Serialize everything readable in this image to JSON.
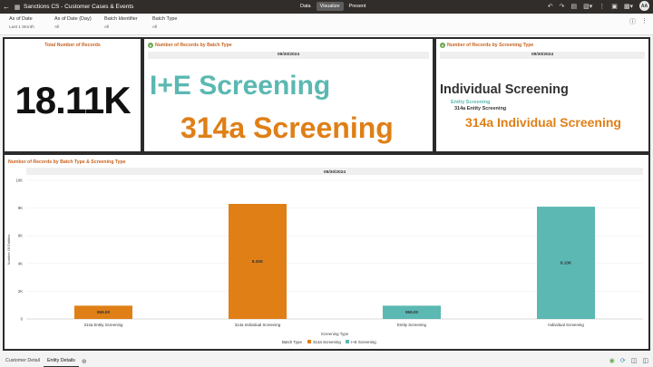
{
  "app": {
    "title": "Sanctions CS - Customer Cases & Events",
    "modes": [
      "Data",
      "Visualize",
      "Present"
    ],
    "active_mode": "Visualize",
    "avatar_initials": "AA"
  },
  "filters": [
    {
      "label": "As of Date",
      "value": "Last 1 Month"
    },
    {
      "label": "As of Date (Day)",
      "value": "All"
    },
    {
      "label": "Batch Identifier",
      "value": "All"
    },
    {
      "label": "Batch Type",
      "value": "All"
    }
  ],
  "tiles": {
    "total": {
      "title": "Total Number of Records",
      "value": "18.11K"
    },
    "by_batch": {
      "title": "Number of Records by Batch Type",
      "date": "09/30/2024",
      "words": [
        "I+E Screening",
        "314a Screening"
      ]
    },
    "by_screening": {
      "title": "Number of Records by Screening Type",
      "date": "09/30/2024",
      "words": [
        "Individual Screening",
        "Entity Screening",
        "314a Entity Screening",
        "314a Individual Screening"
      ]
    }
  },
  "chart_data": {
    "type": "bar",
    "title": "Number of Records by Batch Type & Screening Type",
    "facet": "09/30/2024",
    "xlabel": "Screening Type",
    "ylabel": "Number Of Entities",
    "ylim": [
      0,
      10000
    ],
    "yticks": [
      "0",
      "2K",
      "4K",
      "6K",
      "8K",
      "10K"
    ],
    "categories": [
      "314a Entity Screening",
      "314a Individual Screening",
      "Entity Screening",
      "Individual Screening"
    ],
    "series": [
      {
        "name": "314a Screening",
        "color": "#df7f16",
        "values": [
          959,
          8300,
          null,
          null
        ],
        "labels": [
          "959.00",
          "8.30K",
          "",
          ""
        ]
      },
      {
        "name": "I+E Screening",
        "color": "#5bb8b2",
        "values": [
          null,
          null,
          959,
          8100
        ],
        "labels": [
          "",
          "",
          "959.00",
          "8.10K"
        ]
      }
    ],
    "legend_title": "Batch Type",
    "legend_position": "bottom"
  },
  "bottom_tabs": [
    "Customer Detail",
    "Entity Details"
  ],
  "active_tab": "Entity Details",
  "colors": {
    "accent_orange": "#df7f16",
    "accent_teal": "#5bb8b2",
    "title_orange": "#c7621f"
  }
}
